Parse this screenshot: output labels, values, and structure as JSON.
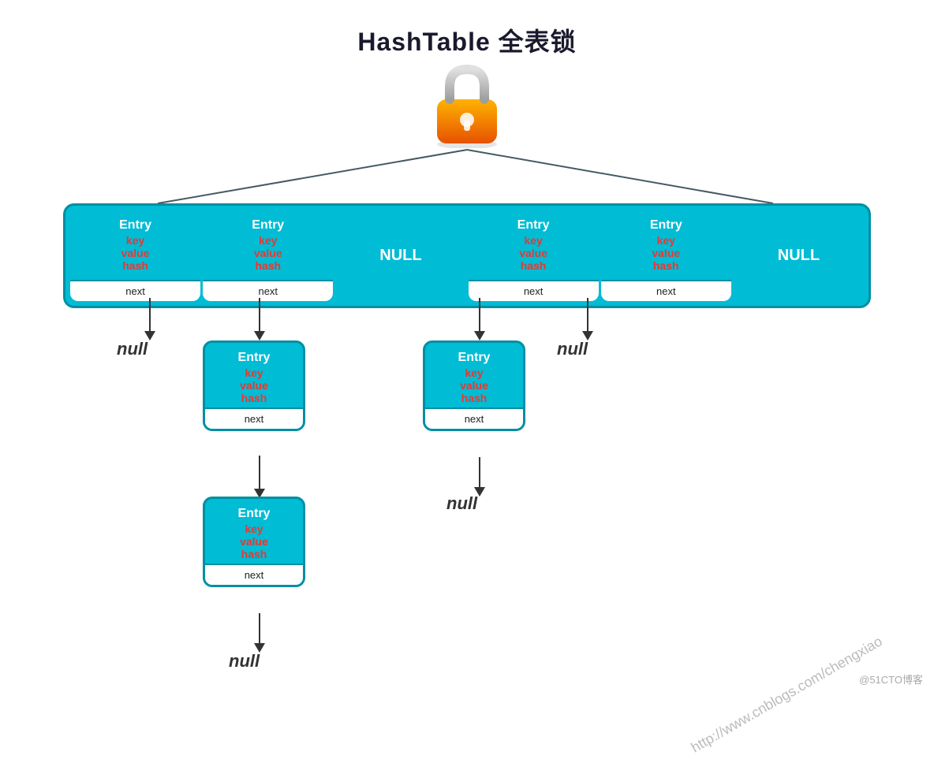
{
  "title": "HashTable 全表锁",
  "lock": {
    "aria": "lock-icon"
  },
  "hashtable_row": {
    "cells": [
      {
        "type": "entry",
        "label": "Entry",
        "key": "key",
        "value": "value",
        "hash": "hash",
        "next": "next"
      },
      {
        "type": "entry",
        "label": "Entry",
        "key": "key",
        "value": "value",
        "hash": "hash",
        "next": "next"
      },
      {
        "type": "null",
        "label": "NULL"
      },
      {
        "type": "entry",
        "label": "Entry",
        "key": "key",
        "value": "value",
        "hash": "hash",
        "next": "next"
      },
      {
        "type": "entry",
        "label": "Entry",
        "key": "key",
        "value": "value",
        "hash": "hash",
        "next": "next"
      },
      {
        "type": "null",
        "label": "NULL"
      }
    ]
  },
  "level2_left": {
    "label": "Entry",
    "key": "key",
    "value": "value",
    "hash": "hash",
    "next": "next"
  },
  "level2_right": {
    "label": "Entry",
    "key": "key",
    "value": "value",
    "hash": "hash",
    "next": "next"
  },
  "level3_left": {
    "label": "Entry",
    "key": "key",
    "value": "value",
    "hash": "hash",
    "next": "next"
  },
  "nulls": {
    "null1": "null",
    "null2": "null",
    "null3": "null",
    "null4": "null"
  },
  "watermark": {
    "line1": "http://www.cnblogs.com/chengxiao",
    "footer": "@51CTO博客"
  }
}
